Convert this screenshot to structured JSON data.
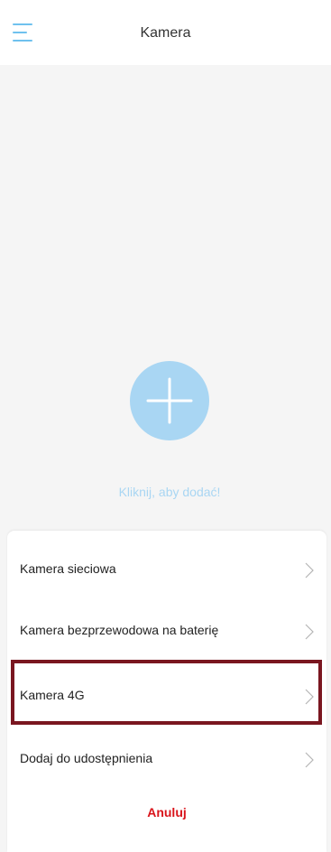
{
  "header": {
    "title": "Kamera",
    "menu_icon": "hamburger-menu-icon"
  },
  "add_area": {
    "icon": "plus-icon",
    "hint": "Kliknij, aby dodać!"
  },
  "add_menu": {
    "items": [
      {
        "label": "Kamera sieciowa",
        "icon": "chevron-right-icon"
      },
      {
        "label": "Kamera bezprzewodowa na baterię",
        "icon": "chevron-right-icon"
      },
      {
        "label": "Kamera 4G",
        "icon": "chevron-right-icon",
        "highlighted": true
      },
      {
        "label": "Dodaj do udostępnienia",
        "icon": "chevron-right-icon"
      }
    ],
    "cancel_label": "Anuluj"
  },
  "colors": {
    "accent": "#6fc1ee",
    "add_circle": "#a9d6f3",
    "cancel": "#d9141b",
    "highlight_border": "#7a1620",
    "background": "#f5f5f5"
  }
}
